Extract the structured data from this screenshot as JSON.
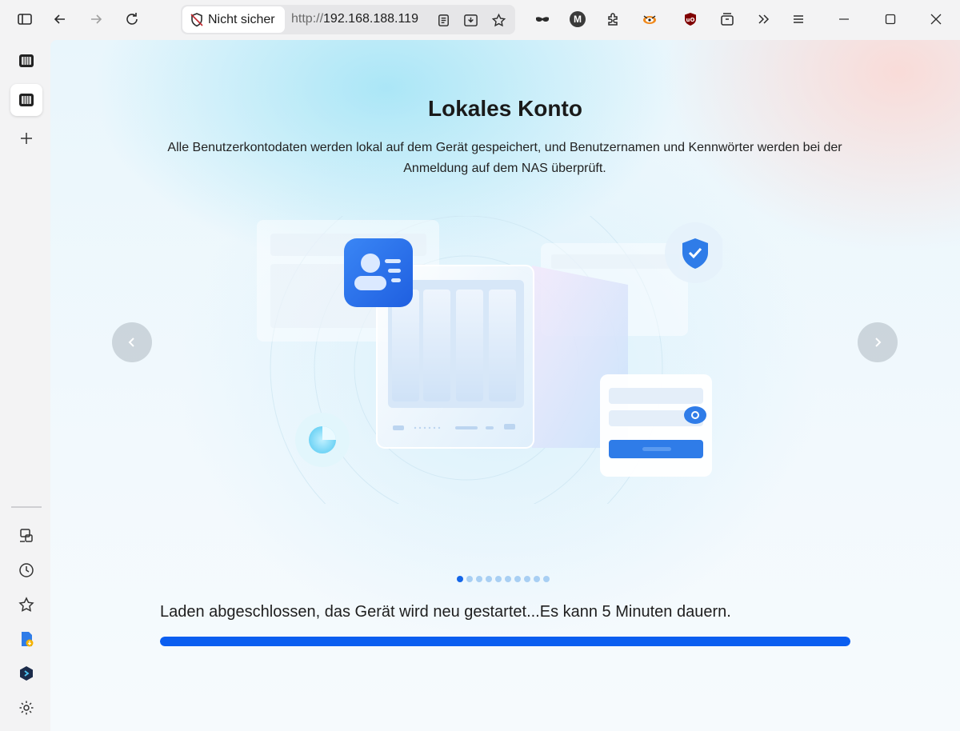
{
  "browser": {
    "security_label": "Nicht sicher",
    "url_scheme": "http://",
    "url_host": "192.168.188.119",
    "icons": [
      "sidebar-toggle-icon",
      "back-icon",
      "forward-icon",
      "reload-icon",
      "reader-view-icon",
      "download-icon",
      "bookmark-star-icon",
      "mask-icon",
      "profile-m-icon",
      "extensions-icon",
      "fox-extension-icon",
      "ublock-icon",
      "archive-icon",
      "overflow-icon",
      "menu-icon",
      "minimize-icon",
      "maximize-icon",
      "close-icon"
    ],
    "profile_letter": "M",
    "ublock_text": "uO"
  },
  "sidebar": {
    "items": [
      {
        "name": "tab-nas-1",
        "icon": "nas-tab-icon"
      },
      {
        "name": "tab-nas-2",
        "icon": "nas-tab-icon",
        "active": true
      },
      {
        "name": "new-tab",
        "icon": "plus-icon"
      },
      {
        "name": "synced-tabs",
        "icon": "devices-icon"
      },
      {
        "name": "history",
        "icon": "clock-icon"
      },
      {
        "name": "bookmarks",
        "icon": "star-icon"
      },
      {
        "name": "downloads-ext",
        "icon": "file-download-icon"
      },
      {
        "name": "extension-shield",
        "icon": "shield-cube-icon"
      },
      {
        "name": "settings",
        "icon": "gear-icon"
      }
    ]
  },
  "page": {
    "title": "Lokales Konto",
    "description": "Alle Benutzerkontodaten werden lokal auf dem Gerät gespeichert, und Benutzernamen und Kennwörter werden bei der Anmeldung auf dem NAS überprüft.",
    "carousel": {
      "total": 10,
      "active_index": 0
    },
    "status_text": "Laden abgeschlossen, das Gerät wird neu gestartet...Es kann 5 Minuten dauern.",
    "progress_fraction": 1.0
  },
  "colors": {
    "accent": "#0b5ef0",
    "dot_inactive": "#a8cff3"
  }
}
